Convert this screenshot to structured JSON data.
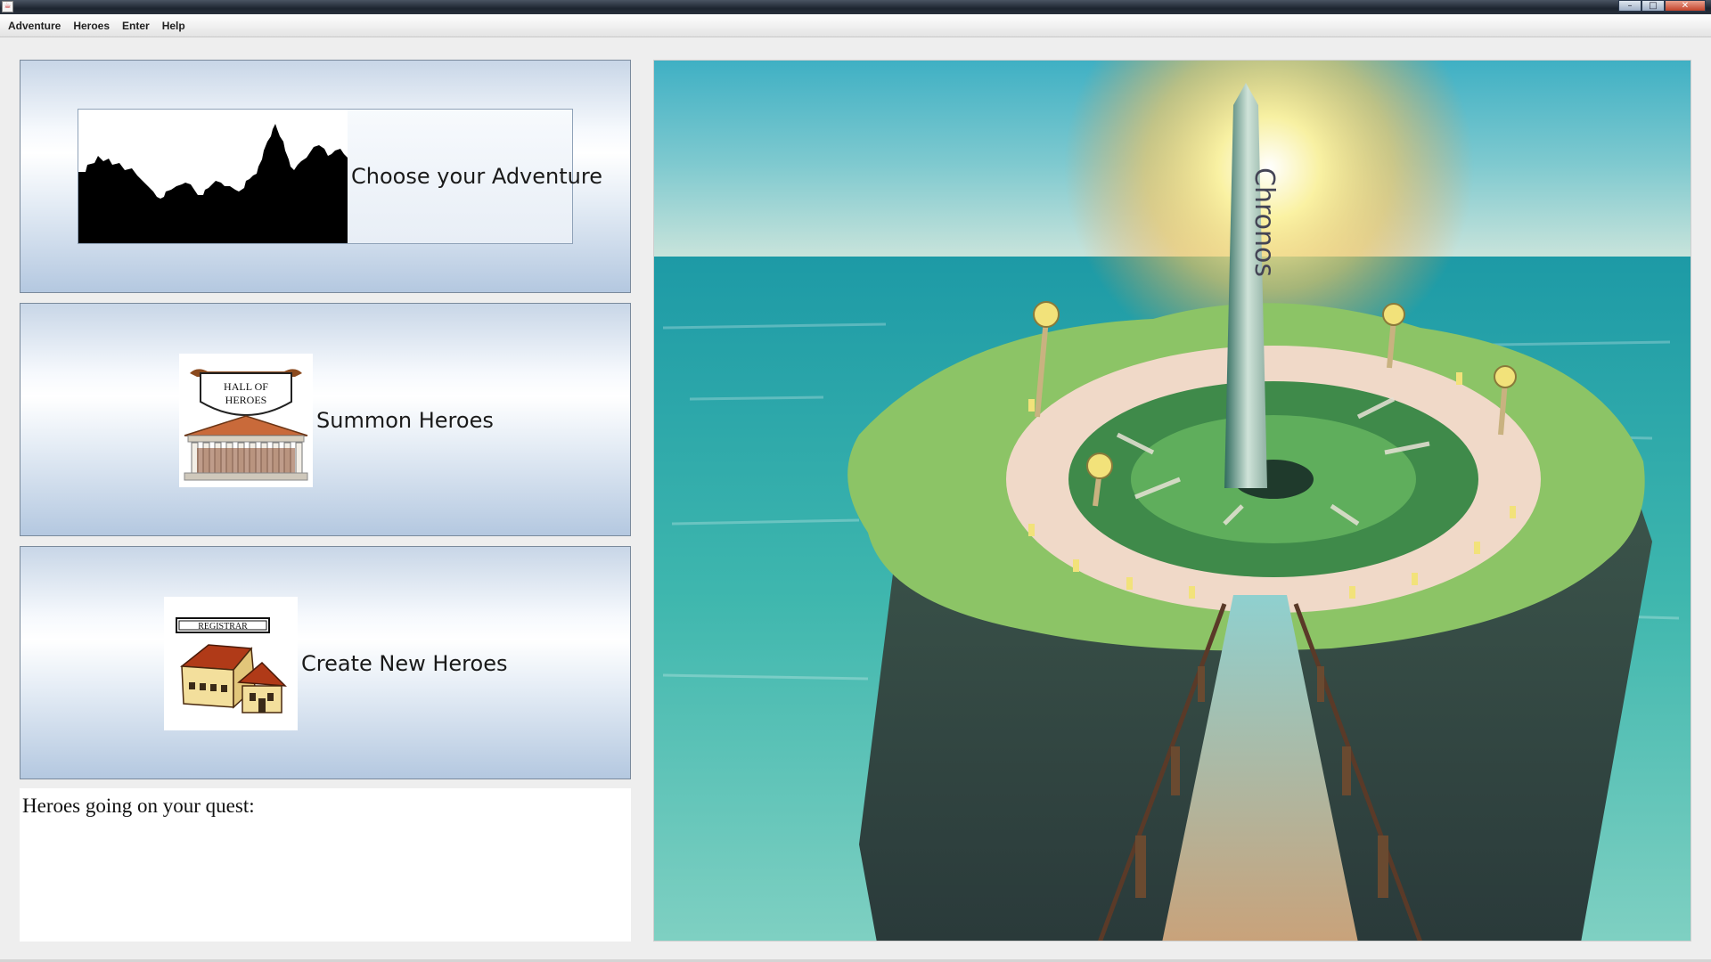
{
  "window": {
    "title": "",
    "controls": {
      "minimize": "–",
      "maximize": "□",
      "close": "✕"
    }
  },
  "menubar": {
    "items": [
      {
        "id": "adventure",
        "label": "Adventure"
      },
      {
        "id": "heroes",
        "label": "Heroes"
      },
      {
        "id": "enter",
        "label": "Enter"
      },
      {
        "id": "help",
        "label": "Help"
      }
    ]
  },
  "left_panel": {
    "choose_adventure": {
      "label": "Choose your Adventure",
      "icon": "city-skyline-silhouette-icon"
    },
    "summon_heroes": {
      "label": "Summon Heroes",
      "icon": "hall-of-heroes-icon",
      "icon_text": [
        "HALL OF",
        "HEROES"
      ]
    },
    "create_heroes": {
      "label": "Create New Heroes",
      "icon": "registrar-building-icon",
      "icon_text": "REGISTRAR"
    }
  },
  "quest_panel": {
    "label": "Heroes going on your quest:"
  },
  "artwork": {
    "name": "chronos-island-illustration",
    "obelisk_text": "Chronos"
  },
  "colors": {
    "button_gradient_top": "#c8d6e7",
    "button_gradient_bottom": "#b4c8e0",
    "sea": "#2aa3a8",
    "grass": "#8cc466"
  }
}
